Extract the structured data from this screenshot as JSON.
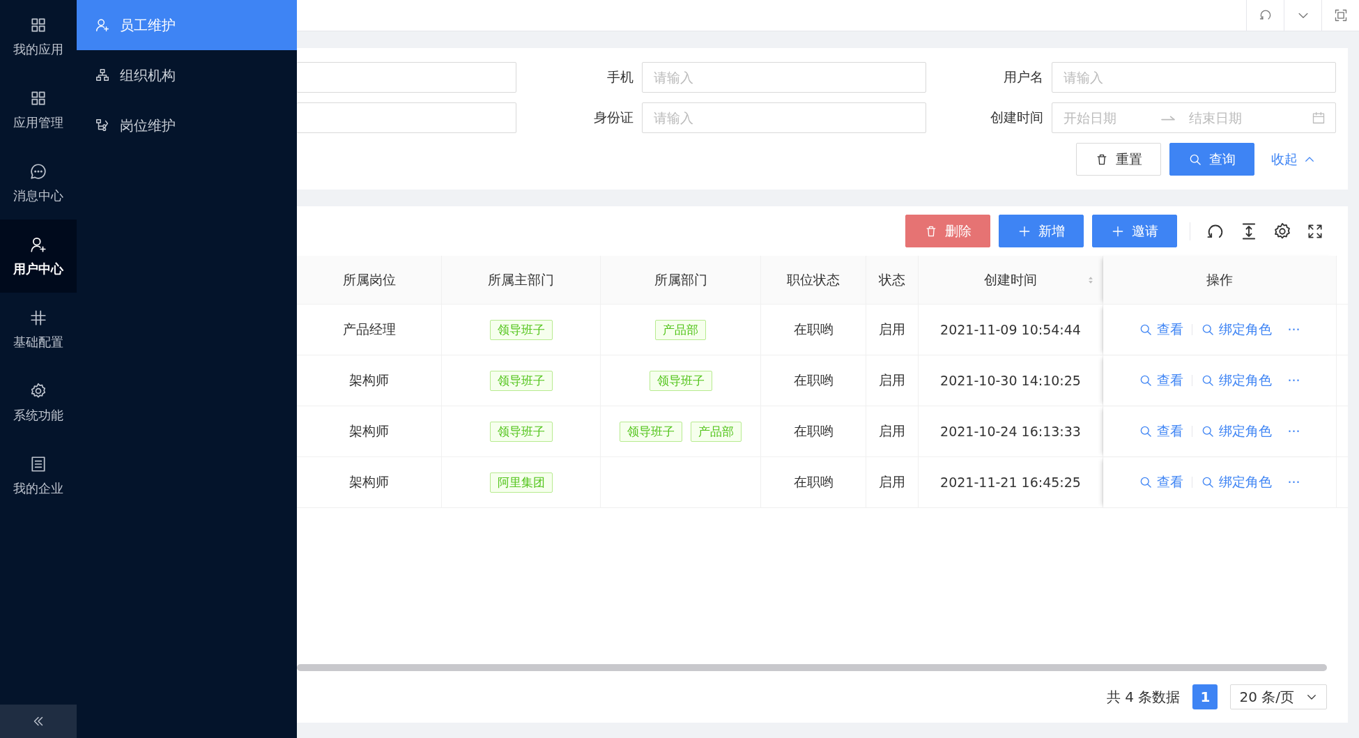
{
  "rail": {
    "items": [
      {
        "label": "我的应用",
        "selected": false
      },
      {
        "label": "应用管理",
        "selected": false
      },
      {
        "label": "消息中心",
        "selected": false
      },
      {
        "label": "用户中心",
        "selected": true
      },
      {
        "label": "基础配置",
        "selected": false
      },
      {
        "label": "系统功能",
        "selected": false
      },
      {
        "label": "我的企业",
        "selected": false
      }
    ]
  },
  "submenu": {
    "items": [
      {
        "label": "员工维护",
        "selected": true
      },
      {
        "label": "组织机构",
        "selected": false
      },
      {
        "label": "岗位维护",
        "selected": false
      }
    ]
  },
  "filters": {
    "rows": [
      [
        {
          "kind": "input"
        },
        {
          "kind": "input",
          "label": "手机",
          "placeholder": "请输入"
        },
        {
          "kind": "input",
          "label": "用户名",
          "placeholder": "请输入"
        }
      ],
      [
        {
          "kind": "input"
        },
        {
          "kind": "input",
          "label": "身份证",
          "placeholder": "请输入"
        },
        {
          "kind": "daterange",
          "label": "创建时间",
          "start_placeholder": "开始日期",
          "end_placeholder": "结束日期"
        }
      ]
    ],
    "buttons": [
      {
        "label": "重置",
        "kind": "default"
      },
      {
        "label": "查询",
        "kind": "primary"
      }
    ],
    "collapse": "收起"
  },
  "toolbar": {
    "buttons": [
      {
        "label": "删除",
        "kind": "danger"
      },
      {
        "label": "新增",
        "kind": "primary"
      },
      {
        "label": "邀请",
        "kind": "primary"
      }
    ]
  },
  "table": {
    "columns": [
      {
        "label": "所属岗位",
        "sortable": false
      },
      {
        "label": "所属主部门",
        "sortable": false
      },
      {
        "label": "所属部门",
        "sortable": false
      },
      {
        "label": "职位状态",
        "sortable": false
      },
      {
        "label": "状态",
        "sortable": false
      },
      {
        "label": "创建时间",
        "sortable": true
      },
      {
        "label": "操作",
        "sortable": false
      }
    ],
    "rows": [
      {
        "position": "产品经理",
        "main_dept": [
          "领导班子"
        ],
        "depts": [
          "产品部"
        ],
        "job_status": "在职哟",
        "status": "启用",
        "created": "2021-11-09 10:54:44",
        "actions": [
          "查看",
          "绑定角色"
        ],
        "more": "···"
      },
      {
        "position": "架构师",
        "main_dept": [
          "领导班子"
        ],
        "depts": [
          "领导班子"
        ],
        "job_status": "在职哟",
        "status": "启用",
        "created": "2021-10-30 14:10:25",
        "actions": [
          "查看",
          "绑定角色"
        ],
        "more": "···"
      },
      {
        "position": "架构师",
        "main_dept": [
          "领导班子"
        ],
        "depts": [
          "领导班子",
          "产品部"
        ],
        "job_status": "在职哟",
        "status": "启用",
        "created": "2021-10-24 16:13:33",
        "actions": [
          "查看",
          "绑定角色"
        ],
        "more": "···"
      },
      {
        "position": "架构师",
        "main_dept": [
          "阿里集团"
        ],
        "depts": [],
        "job_status": "在职哟",
        "status": "启用",
        "created": "2021-11-21 16:45:25",
        "actions": [
          "查看",
          "绑定角色"
        ],
        "more": "···"
      }
    ]
  },
  "pagination": {
    "total": "共 4 条数据",
    "pages": [
      {
        "label": "1",
        "selected": true
      }
    ],
    "page_size": "20 条/页"
  }
}
